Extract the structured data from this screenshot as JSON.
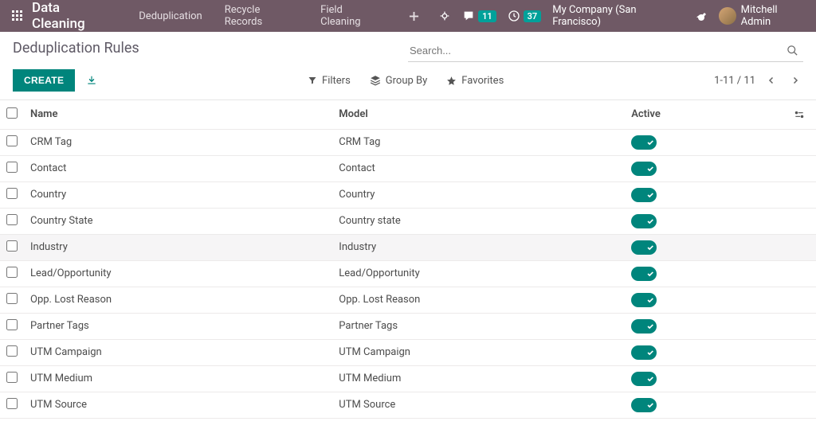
{
  "nav": {
    "brand": "Data Cleaning",
    "links": [
      "Deduplication",
      "Recycle Records",
      "Field Cleaning"
    ],
    "messages_badge": "11",
    "timer_badge": "37",
    "company": "My Company (San Francisco)",
    "user": "Mitchell Admin"
  },
  "page": {
    "title": "Deduplication Rules",
    "search_placeholder": "Search...",
    "create_label": "Create",
    "filters_label": "Filters",
    "groupby_label": "Group By",
    "favorites_label": "Favorites",
    "pager": "1-11 / 11"
  },
  "table": {
    "headers": {
      "name": "Name",
      "model": "Model",
      "active": "Active"
    },
    "rows": [
      {
        "name": "CRM Tag",
        "model": "CRM Tag",
        "active": true
      },
      {
        "name": "Contact",
        "model": "Contact",
        "active": true
      },
      {
        "name": "Country",
        "model": "Country",
        "active": true
      },
      {
        "name": "Country State",
        "model": "Country state",
        "active": true
      },
      {
        "name": "Industry",
        "model": "Industry",
        "active": true,
        "highlight": true
      },
      {
        "name": "Lead/Opportunity",
        "model": "Lead/Opportunity",
        "active": true
      },
      {
        "name": "Opp. Lost Reason",
        "model": "Opp. Lost Reason",
        "active": true
      },
      {
        "name": "Partner Tags",
        "model": "Partner Tags",
        "active": true
      },
      {
        "name": "UTM Campaign",
        "model": "UTM Campaign",
        "active": true
      },
      {
        "name": "UTM Medium",
        "model": "UTM Medium",
        "active": true
      },
      {
        "name": "UTM Source",
        "model": "UTM Source",
        "active": true
      }
    ]
  }
}
